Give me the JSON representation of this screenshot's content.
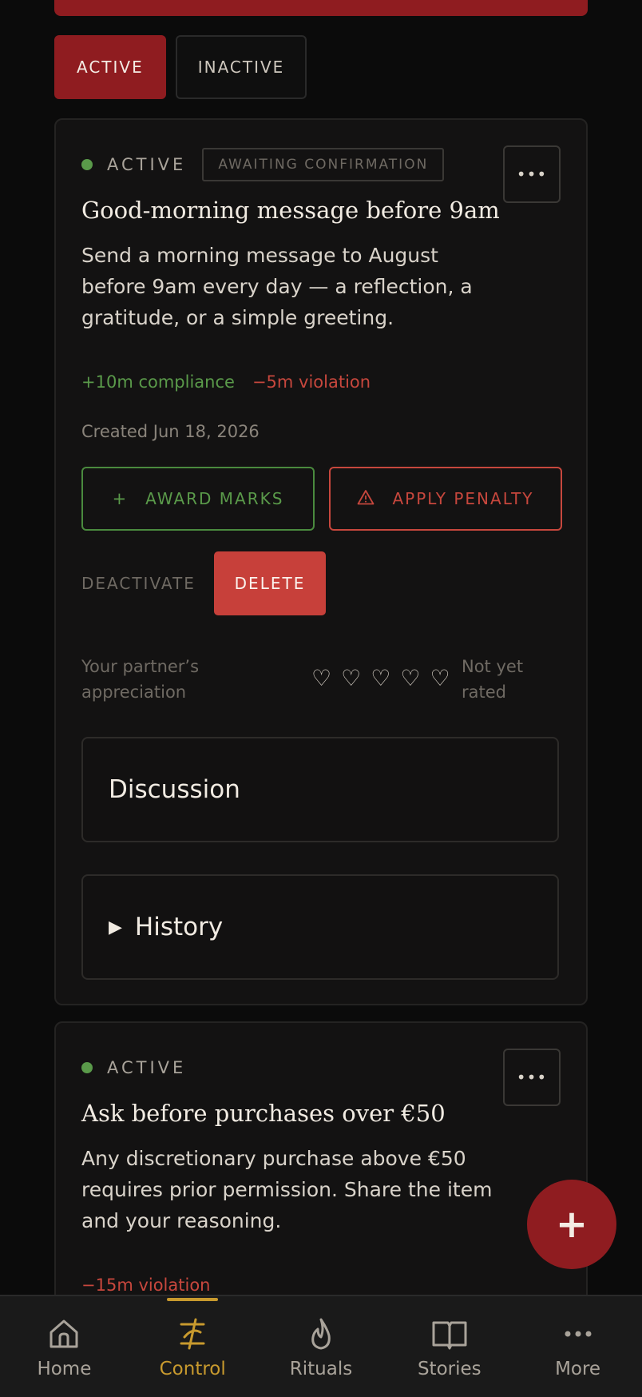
{
  "filters": {
    "active_label": "ACTIVE",
    "inactive_label": "INACTIVE"
  },
  "card1": {
    "status": "ACTIVE",
    "badge": "AWAITING CONFIRMATION",
    "menu": "•••",
    "title": "Good-morning message before 9am",
    "description": "Send a morning message to August before 9am every day — a reflection, a gratitude, or a simple greeting.",
    "compliance": "+10m compliance",
    "violation": "−5m violation",
    "created": "Created Jun 18, 2026",
    "award_label": "AWARD MARKS",
    "penalty_label": "APPLY PENALTY",
    "deactivate_label": "DEACTIVATE",
    "delete_label": "DELETE",
    "appreciation_label": "Your partner’s appreciation",
    "rating_status": "Not yet rated",
    "discussion_label": "Discussion",
    "history_label": "History"
  },
  "card2": {
    "status": "ACTIVE",
    "menu": "•••",
    "title": "Ask before purchases over €50",
    "description": "Any discretionary purchase above €50 requires prior permission. Share the item and your reasoning.",
    "violation": "−15m violation"
  },
  "fab_label": "+",
  "nav": [
    {
      "label": "Home",
      "icon": "home-icon"
    },
    {
      "label": "Control",
      "icon": "control-icon"
    },
    {
      "label": "Rituals",
      "icon": "flame-icon"
    },
    {
      "label": "Stories",
      "icon": "book-icon"
    },
    {
      "label": "More",
      "icon": "more-icon"
    }
  ],
  "colors": {
    "accent_red": "#8f1c20",
    "danger": "#c7403a",
    "success": "#5a9a4a",
    "active_nav": "#c89a2e",
    "background": "#0b0b0b"
  },
  "appreciation": {
    "rating": 0,
    "max": 5
  }
}
